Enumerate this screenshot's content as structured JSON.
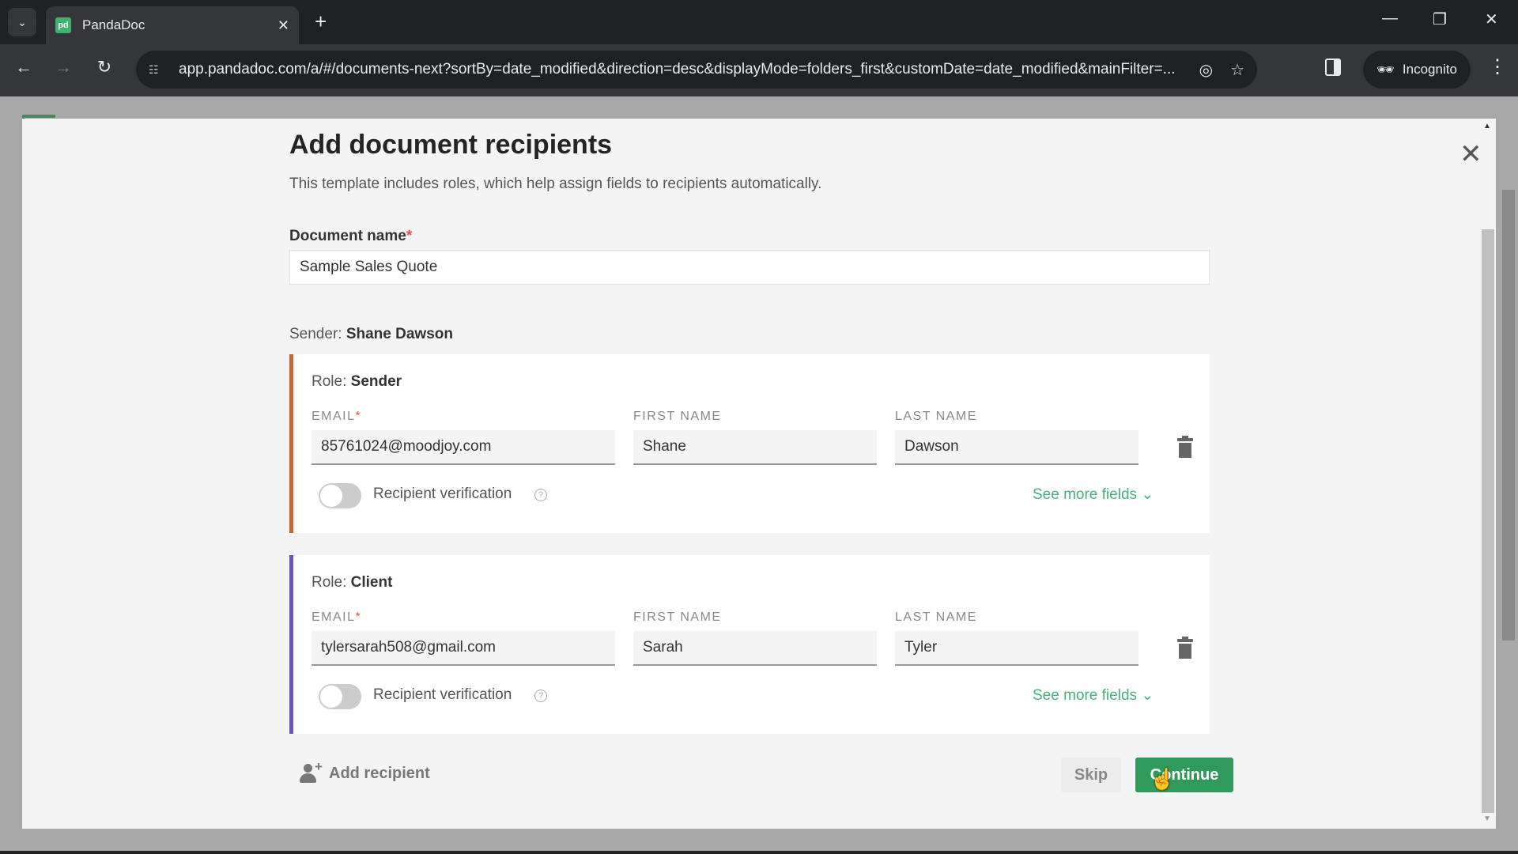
{
  "browser": {
    "tab_title": "PandaDoc",
    "favicon_text": "pd",
    "url": "app.pandadoc.com/a/#/documents-next?sortBy=date_modified&direction=desc&displayMode=folders_first&customDate=date_modified&mainFilter=...",
    "incognito_label": "Incognito"
  },
  "modal": {
    "title": "Add document recipients",
    "subtitle": "This template includes roles, which help assign fields to recipients automatically.",
    "document_name_label": "Document name",
    "required_mark": "*",
    "document_name_value": "Sample Sales Quote",
    "sender_prefix": "Sender: ",
    "sender_name": "Shane Dawson",
    "labels": {
      "email": "EMAIL",
      "first_name": "FIRST NAME",
      "last_name": "LAST NAME",
      "recipient_verification": "Recipient verification",
      "see_more_fields": "See more fields ⌄",
      "role_prefix": "Role: "
    },
    "recipients": [
      {
        "role": "Sender",
        "accent_color": "#c36b2e",
        "email": "85761024@moodjoy.com",
        "first_name": "Shane",
        "last_name": "Dawson",
        "verification_enabled": false
      },
      {
        "role": "Client",
        "accent_color": "#6b55b8",
        "email": "tylersarah508@gmail.com",
        "first_name": "Sarah",
        "last_name": "Tyler",
        "verification_enabled": false
      }
    ],
    "add_recipient_label": "Add recipient",
    "skip_label": "Skip",
    "continue_label": "Continue"
  },
  "colors": {
    "primary_green": "#2f9a5a",
    "link_green": "#47b17a",
    "required_red": "#d9534f"
  }
}
